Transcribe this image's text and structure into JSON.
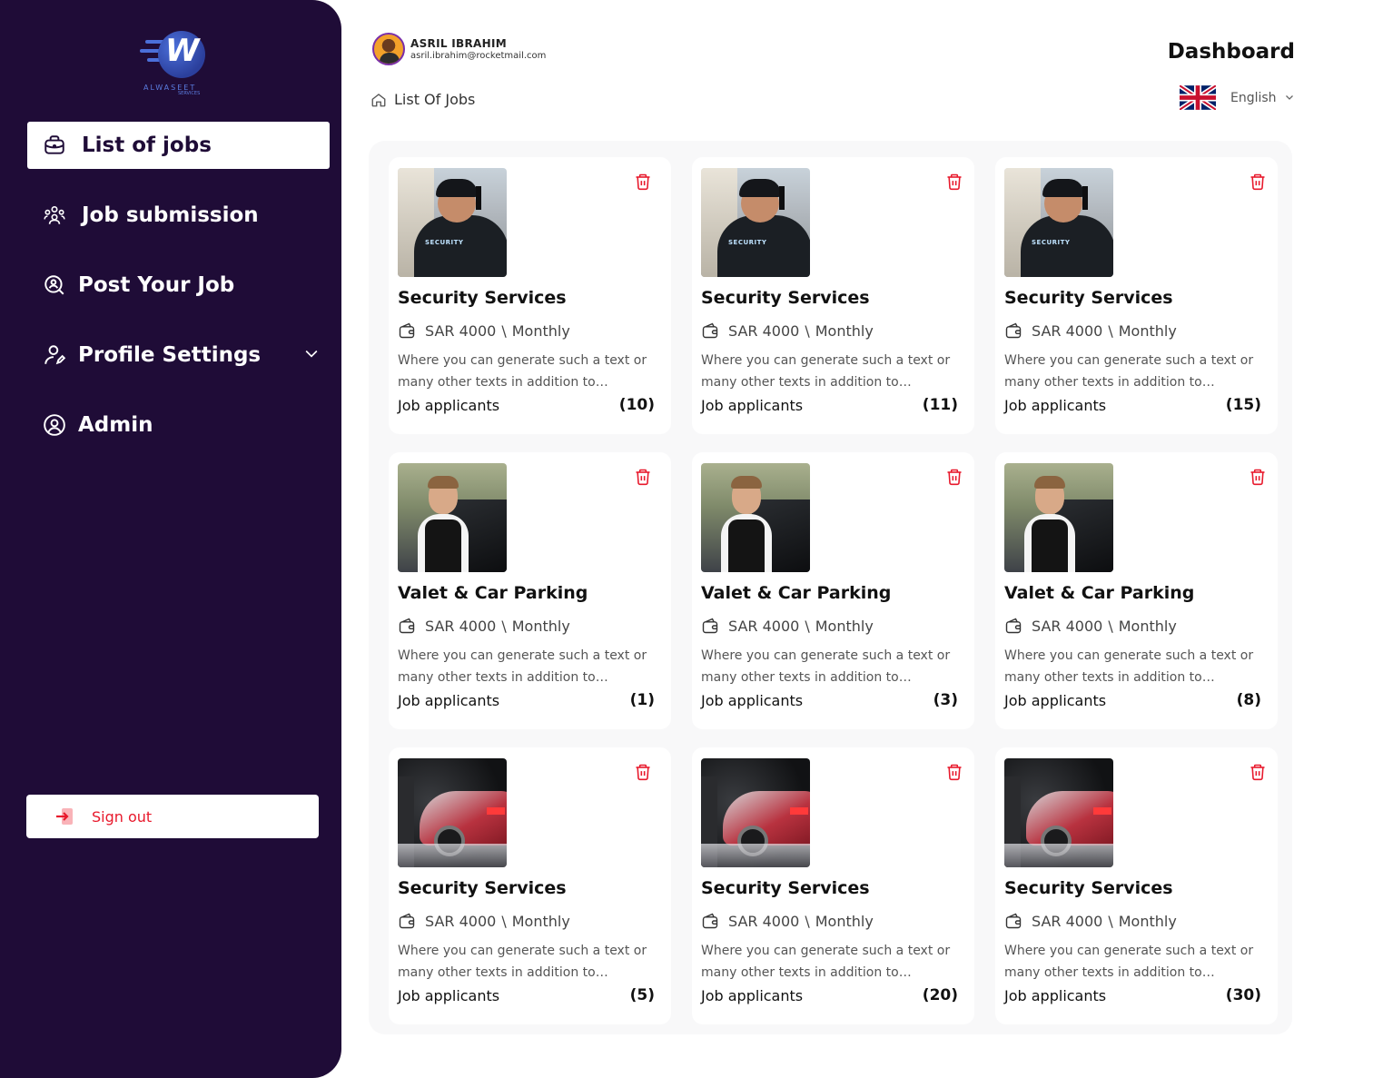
{
  "app": {
    "brand": "ALWASEET",
    "brand_sub": "SERVICES",
    "page_title": "Dashboard"
  },
  "user": {
    "name": "ASRIL IBRAHIM",
    "email": "asril.ibrahim@rocketmail.com"
  },
  "breadcrumb": {
    "label": "List Of Jobs"
  },
  "language": {
    "selected": "English",
    "flag_icon": "uk-flag-icon"
  },
  "sidebar": {
    "items": [
      {
        "label": "List of jobs",
        "icon": "briefcase-icon",
        "active": true
      },
      {
        "label": "Job submission",
        "icon": "users-icon",
        "active": false
      },
      {
        "label": "Post Your Job",
        "icon": "search-user-icon",
        "active": false
      },
      {
        "label": "Profile Settings",
        "icon": "user-edit-icon",
        "active": false,
        "has_dropdown": true
      },
      {
        "label": "Admin",
        "icon": "user-circle-icon",
        "active": false
      }
    ],
    "signout": {
      "label": "Sign out",
      "icon": "logout-icon"
    }
  },
  "colors": {
    "sidebar_bg": "#1f0c37",
    "accent_red": "#e8192c",
    "panel_bg": "#f8f8f9"
  },
  "jobs": [
    {
      "title": "Security Services",
      "salary": "SAR 4000",
      "period": "Monthly",
      "sep": "\\",
      "description": "Where you can generate such a text or many other texts in addition to increasing the number of characters",
      "applicants_label": "Job applicants",
      "applicants_count": "(10)",
      "image": "security-guard"
    },
    {
      "title": "Security Services",
      "salary": "SAR 4000",
      "period": "Monthly",
      "sep": "\\",
      "description": "Where you can generate such a text or many other texts in addition to increasing the number of characters",
      "applicants_label": "Job applicants",
      "applicants_count": "(11)",
      "image": "security-guard"
    },
    {
      "title": "Security Services",
      "salary": "SAR 4000",
      "period": "Monthly",
      "sep": "\\",
      "description": "Where you can generate such a text or many other texts in addition to increasing the number of characters",
      "applicants_label": "Job applicants",
      "applicants_count": "(15)",
      "image": "security-guard"
    },
    {
      "title": "Valet & Car Parking",
      "salary": "SAR 4000",
      "period": "Monthly",
      "sep": "\\",
      "description": "Where you can generate such a text or many other texts in addition to increasing the number of characters",
      "applicants_label": "Job applicants",
      "applicants_count": "(1)",
      "image": "valet"
    },
    {
      "title": "Valet & Car Parking",
      "salary": "SAR 4000",
      "period": "Monthly",
      "sep": "\\",
      "description": "Where you can generate such a text or many other texts in addition to increasing the number of characters",
      "applicants_label": "Job applicants",
      "applicants_count": "(3)",
      "image": "valet"
    },
    {
      "title": "Valet & Car Parking",
      "salary": "SAR 4000",
      "period": "Monthly",
      "sep": "\\",
      "description": "Where you can generate such a text or many other texts in addition to increasing the number of characters",
      "applicants_label": "Job applicants",
      "applicants_count": "(8)",
      "image": "valet"
    },
    {
      "title": "Security Services",
      "salary": "SAR 4000",
      "period": "Monthly",
      "sep": "\\",
      "description": "Where you can generate such a text or many other texts in addition to increasing the number of characters",
      "applicants_label": "Job applicants",
      "applicants_count": "(5)",
      "image": "car-wash"
    },
    {
      "title": "Security Services",
      "salary": "SAR 4000",
      "period": "Monthly",
      "sep": "\\",
      "description": "Where you can generate such a text or many other texts in addition to increasing the number of characters",
      "applicants_label": "Job applicants",
      "applicants_count": "(20)",
      "image": "car-wash"
    },
    {
      "title": "Security Services",
      "salary": "SAR 4000",
      "period": "Monthly",
      "sep": "\\",
      "description": "Where you can generate such a text or many other texts in addition to increasing the number of characters",
      "applicants_label": "Job applicants",
      "applicants_count": "(30)",
      "image": "car-wash"
    }
  ]
}
